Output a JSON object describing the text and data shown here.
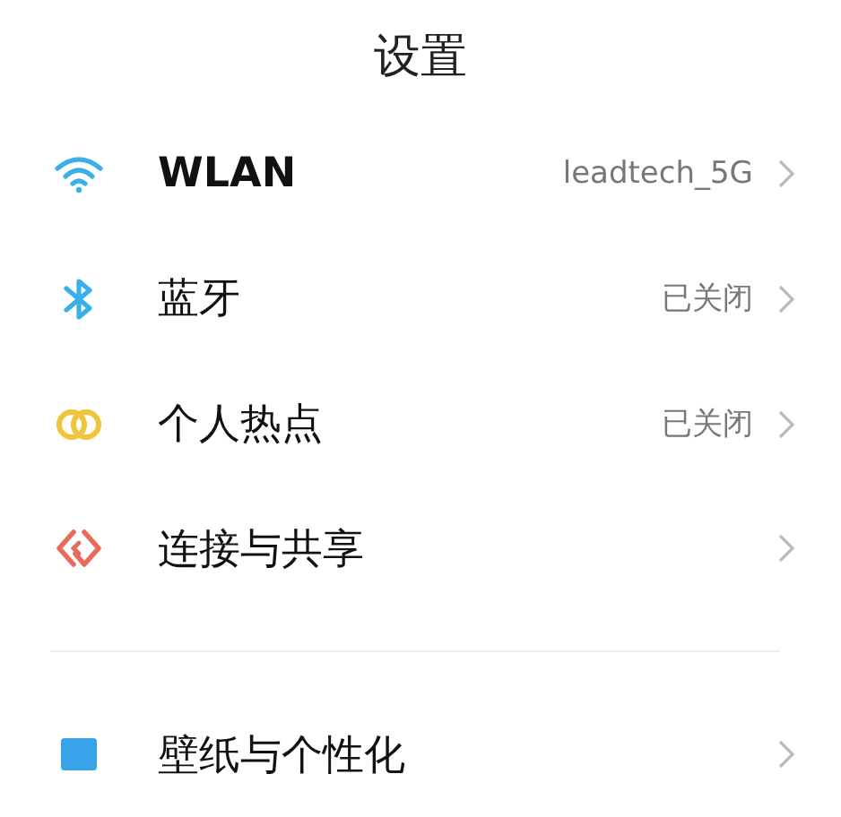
{
  "title": "设置",
  "groups": [
    {
      "items": [
        {
          "kind": "wifi",
          "label": "WLAN",
          "value": "leadtech_5G"
        },
        {
          "kind": "bluetooth",
          "label": "蓝牙",
          "value": "已关闭"
        },
        {
          "kind": "hotspot",
          "label": "个人热点",
          "value": "已关闭"
        },
        {
          "kind": "share",
          "label": "连接与共享"
        }
      ]
    },
    {
      "items": [
        {
          "kind": "wallpaper",
          "label": "壁纸与个性化"
        }
      ]
    }
  ]
}
